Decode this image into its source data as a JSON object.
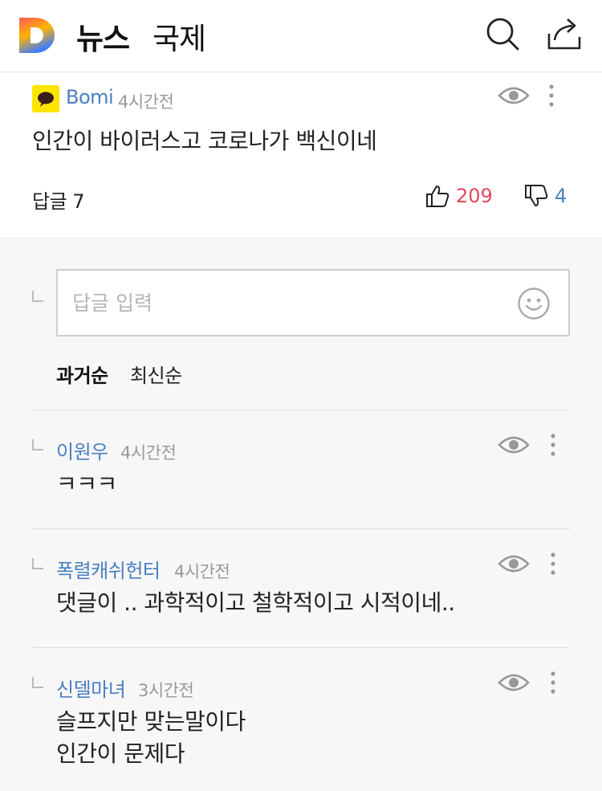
{
  "header": {
    "section": "뉴스",
    "category": "국제",
    "colors": {
      "logo_top": "#ff5a5a",
      "logo_mid": "#ffb400",
      "logo_bottom": "#3d7bff"
    }
  },
  "top_comment": {
    "author": "Bomi",
    "time": "4시간전",
    "text": "인간이 바이러스고 코로나가 백신이네",
    "reply_label": "답글 7",
    "likes": "209",
    "dislikes": "4"
  },
  "reply_box": {
    "placeholder": "답글 입력"
  },
  "sort": {
    "oldest": "과거순",
    "newest": "최신순"
  },
  "replies": [
    {
      "author": "이원우",
      "time": "4시간전",
      "lines": [
        "ㅋㅋㅋ"
      ]
    },
    {
      "author": "폭렬캐쉬헌터",
      "time": "4시간전",
      "lines": [
        "댓글이 .. 과학적이고 철학적이고 시적이네.."
      ]
    },
    {
      "author": "신델마녀",
      "time": "3시간전",
      "lines": [
        "슬프지만 맞는말이다",
        "인간이 문제다"
      ]
    }
  ]
}
